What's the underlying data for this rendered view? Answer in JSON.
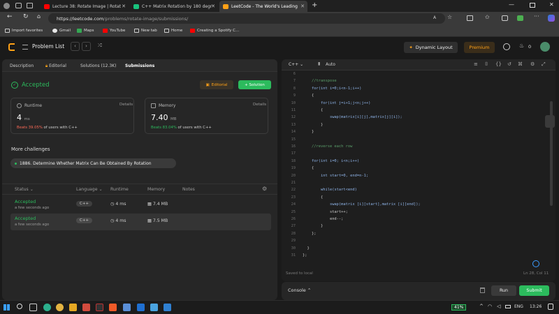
{
  "browser": {
    "tabs": [
      {
        "title": "Lecture 38: Rotate Image | Rotat",
        "color": "#ff0000"
      },
      {
        "title": "C++ Matrix Rotation by 180 degr",
        "color": "#19c37d"
      },
      {
        "title": "LeetCode - The World's Leading",
        "color": "#ffa116"
      }
    ],
    "url_host": "https://leetcode.com",
    "url_path": "/problems/rotate-image/submissions/",
    "bookmarks": [
      "Import favorites",
      "Gmail",
      "Maps",
      "YouTube",
      "New tab",
      "Home",
      "Creating a Spotify C..."
    ]
  },
  "leetcode_header": {
    "problem_list": "Problem List",
    "dynamic_layout": "Dynamic Layout",
    "premium": "Premium",
    "streak": "0"
  },
  "left": {
    "tabs": [
      "Description",
      "Editorial",
      "Solutions (12.3K)",
      "Submissions"
    ],
    "status": "Accepted",
    "editorial_btn": "Editorial",
    "solution_btn": "+ Solution",
    "runtime": {
      "label": "Runtime",
      "details": "Details",
      "value": "4",
      "unit": "ms",
      "beats": "Beats 39.05%",
      "suffix": "of users with C++"
    },
    "memory": {
      "label": "Memory",
      "details": "Details",
      "value": "7.40",
      "unit": "MB",
      "beats": "Beats 83.04%",
      "suffix": "of users with C++"
    },
    "more_challenges": "More challenges",
    "challenge": "1886. Determine Whether Matrix Can Be Obtained By Rotation",
    "table_headers": [
      "Status",
      "Language",
      "Runtime",
      "Memory",
      "Notes"
    ],
    "rows": [
      {
        "status": "Accepted",
        "time": "a few seconds ago",
        "lang": "C++",
        "runtime": "4 ms",
        "memory": "7.4 MB"
      },
      {
        "status": "Accepted",
        "time": "a few seconds ago",
        "lang": "C++",
        "runtime": "4 ms",
        "memory": "7.5 MB"
      }
    ]
  },
  "editor": {
    "language": "C++",
    "mode": "Auto",
    "lines": [
      {
        "n": "6",
        "t": ""
      },
      {
        "n": "7",
        "t": "    //transpose"
      },
      {
        "n": "8",
        "t": "    for(int i=0;i<n-1;i++)"
      },
      {
        "n": "9",
        "t": "    {"
      },
      {
        "n": "10",
        "t": "        for(int j=i+1;j<n;j++)"
      },
      {
        "n": "11",
        "t": "        {"
      },
      {
        "n": "12",
        "t": "            swap(matrix[i][j],matrix[j][i]);"
      },
      {
        "n": "13",
        "t": "        }"
      },
      {
        "n": "14",
        "t": "    }"
      },
      {
        "n": "15",
        "t": ""
      },
      {
        "n": "16",
        "t": "    //reverse each row"
      },
      {
        "n": "17",
        "t": ""
      },
      {
        "n": "18",
        "t": "    for(int i=0; i<n;i++)"
      },
      {
        "n": "19",
        "t": "    {"
      },
      {
        "n": "20",
        "t": "        int start=0, end=n-1;"
      },
      {
        "n": "21",
        "t": ""
      },
      {
        "n": "22",
        "t": "        while(start<end)"
      },
      {
        "n": "23",
        "t": "        {"
      },
      {
        "n": "24",
        "t": "            swap(matrix [i][start],matrix [i][end]);"
      },
      {
        "n": "25",
        "t": "            start++;"
      },
      {
        "n": "26",
        "t": "            end--;"
      },
      {
        "n": "27",
        "t": "        }"
      },
      {
        "n": "28",
        "t": "    };"
      },
      {
        "n": "29",
        "t": ""
      },
      {
        "n": "30",
        "t": "  }"
      },
      {
        "n": "31",
        "t": "};"
      }
    ],
    "saved": "Saved to local",
    "cursor": "Ln 28, Col 11"
  },
  "console": {
    "label": "Console",
    "run": "Run",
    "submit": "Submit"
  },
  "taskbar": {
    "battery": "41%",
    "lang": "ENG",
    "time": "13:26"
  }
}
